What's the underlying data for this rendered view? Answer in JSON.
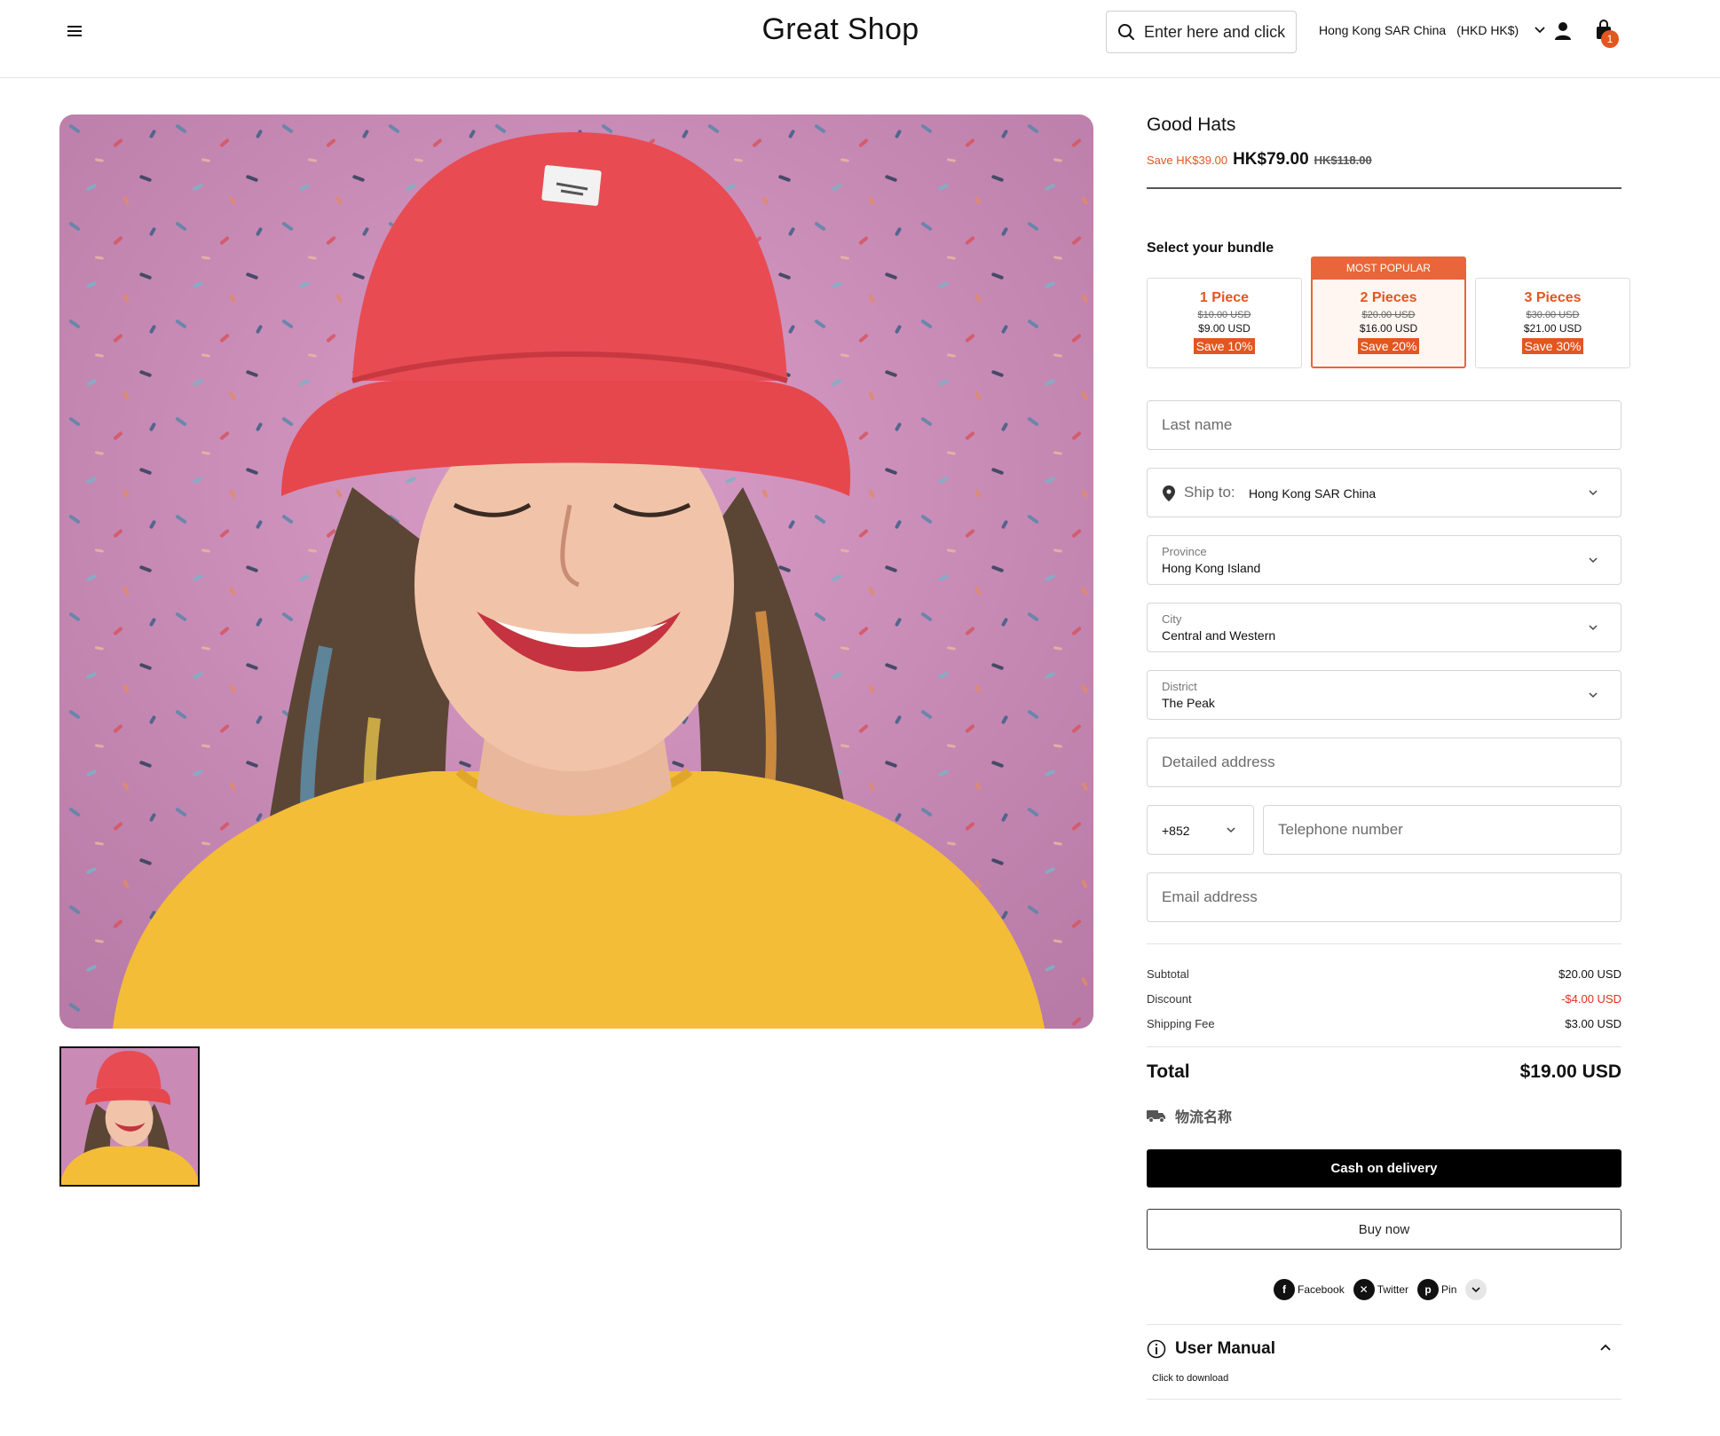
{
  "header": {
    "brand": "Great Shop",
    "search_placeholder": "Enter here and click",
    "region": "Hong Kong SAR China",
    "currency": "(HKD HK$)",
    "cart_count": "1"
  },
  "product": {
    "title": "Good Hats",
    "save_text": "Save HK$39.00",
    "price": "HK$79.00",
    "old_price": "HK$118.00"
  },
  "bundle": {
    "heading": "Select your bundle",
    "popular_label": "MOST POPULAR",
    "options": [
      {
        "qty": "1 Piece",
        "was": "$10.00 USD",
        "now": "$9.00 USD",
        "badge": "Save 10%"
      },
      {
        "qty": "2 Pieces",
        "was": "$20.00 USD",
        "now": "$16.00 USD",
        "badge": "Save 20%"
      },
      {
        "qty": "3 Pieces",
        "was": "$30.00 USD",
        "now": "$21.00 USD",
        "badge": "Save 30%"
      }
    ],
    "selected_index": 1
  },
  "form": {
    "last_name_placeholder": "Last name",
    "ship_label": "Ship to:",
    "ship_value": "Hong Kong SAR China",
    "province_label": "Province",
    "province_value": "Hong Kong Island",
    "city_label": "City",
    "city_value": "Central and Western",
    "district_label": "District",
    "district_value": "The Peak",
    "address_placeholder": "Detailed address",
    "phone_code": "+852",
    "phone_placeholder": "Telephone number",
    "email_placeholder": "Email address"
  },
  "summary": {
    "subtotal_label": "Subtotal",
    "subtotal_value": "$20.00 USD",
    "discount_label": "Discount",
    "discount_value": "-$4.00 USD",
    "shipping_label": "Shipping Fee",
    "shipping_value": "$3.00 USD",
    "total_label": "Total",
    "total_value": "$19.00 USD",
    "logistics_name": "物流名称"
  },
  "actions": {
    "cod_label": "Cash on delivery",
    "buy_label": "Buy now"
  },
  "share": {
    "facebook": "Facebook",
    "twitter": "Twitter",
    "pin": "Pin"
  },
  "manual": {
    "title": "User Manual",
    "subtitle": "Click to download"
  },
  "colors": {
    "accent": "#e2561f",
    "discount": "#e0301e",
    "selected_bg": "#fff6f1"
  }
}
